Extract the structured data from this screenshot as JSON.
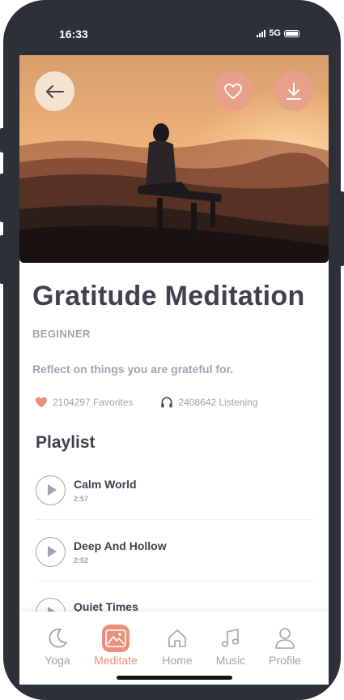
{
  "status_bar": {
    "time": "16:33",
    "network": "5G"
  },
  "header": {
    "back_icon": "arrow-left-icon",
    "favorite_icon": "heart-icon",
    "download_icon": "download-icon"
  },
  "meditation": {
    "title": "Gratitude Meditation",
    "level": "BEGINNER",
    "description": "Reflect on things you are grateful for.",
    "favorites": "2104297 Favorites",
    "listening": "2408642 Listening"
  },
  "playlist": {
    "heading": "Playlist",
    "tracks": [
      {
        "name": "Calm World",
        "duration": "2:57"
      },
      {
        "name": "Deep And Hollow",
        "duration": "2:52"
      },
      {
        "name": "Quiet Times",
        "duration": ""
      }
    ]
  },
  "nav": {
    "items": [
      {
        "label": "Yoga",
        "icon": "moon-icon"
      },
      {
        "label": "Meditate",
        "icon": "mountain-icon"
      },
      {
        "label": "Home",
        "icon": "home-icon"
      },
      {
        "label": "Music",
        "icon": "music-note-icon"
      },
      {
        "label": "Profile",
        "icon": "person-icon"
      }
    ],
    "active": "Meditate"
  },
  "colors": {
    "accent": "#e8907a",
    "text_dark": "#3f414e",
    "text_muted": "#a1a4b2",
    "frame": "#2b3137"
  }
}
